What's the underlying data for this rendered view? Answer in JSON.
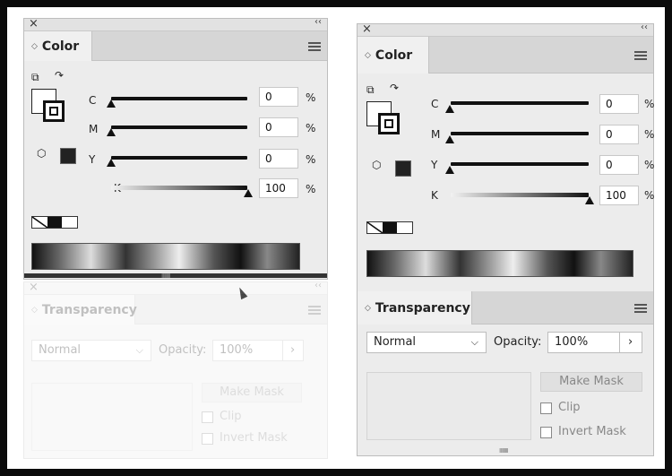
{
  "left": {
    "close_icon": "×",
    "collapse_icon": "‹‹",
    "color_panel": {
      "tab_label": "Color",
      "channels": [
        {
          "name": "C",
          "value": "0",
          "unit": "%"
        },
        {
          "name": "M",
          "value": "0",
          "unit": "%"
        },
        {
          "name": "Y",
          "value": "0",
          "unit": "%"
        },
        {
          "name": "K",
          "value": "100",
          "unit": "%"
        }
      ]
    },
    "transparency_panel": {
      "close_icon": "×",
      "collapse_icon": "‹‹",
      "tab_label": "Transparency",
      "blend_mode": "Normal",
      "opacity_label": "Opacity:",
      "opacity_value": "100%",
      "arrow": "›",
      "make_mask_label": "Make Mask",
      "clip_label": "Clip",
      "invert_label": "Invert Mask"
    }
  },
  "right": {
    "close_icon": "×",
    "collapse_icon": "‹‹",
    "color_panel": {
      "tab_label": "Color",
      "channels": [
        {
          "name": "C",
          "value": "0",
          "unit": "%"
        },
        {
          "name": "M",
          "value": "0",
          "unit": "%"
        },
        {
          "name": "Y",
          "value": "0",
          "unit": "%"
        },
        {
          "name": "K",
          "value": "100",
          "unit": "%"
        }
      ]
    },
    "transparency_panel": {
      "tab_label": "Transparency",
      "blend_mode": "Normal",
      "opacity_label": "Opacity:",
      "opacity_value": "100%",
      "arrow": "›",
      "make_mask_label": "Make Mask",
      "clip_label": "Clip",
      "invert_label": "Invert Mask"
    }
  },
  "grip": "IIIIIIIII",
  "icons": {
    "hamburger": "hamburger-menu-icon",
    "swap": "swap-fill-stroke-icon",
    "cube": "out-of-gamut-cube-icon"
  }
}
